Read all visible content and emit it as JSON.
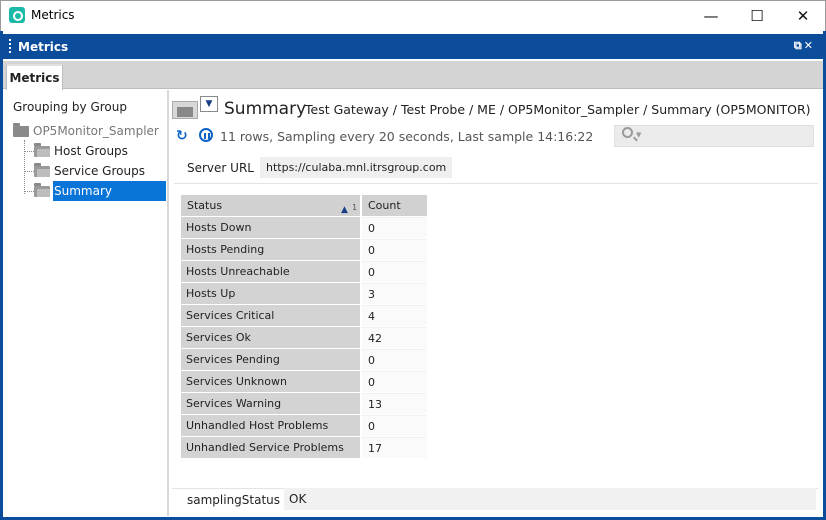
{
  "window": {
    "title": "Metrics",
    "minimize": "—",
    "maximize": "☐",
    "close": "✕"
  },
  "panel": {
    "header_title": "Metrics",
    "header_controls": "⧉✕",
    "tab_label": "Metrics"
  },
  "tree": {
    "grouping_label": "Grouping by Group",
    "root_label": "OP5Monitor_Sampler",
    "items": [
      {
        "label": "Host Groups"
      },
      {
        "label": "Service Groups"
      },
      {
        "label": "Summary"
      }
    ],
    "selected": "Summary"
  },
  "view": {
    "title": "Summary",
    "path": "Test Gateway / Test Probe / ME / OP5Monitor_Sampler / Summary (OP5MONITOR)",
    "status": "11 rows, Sampling every 20 seconds, Last sample 14:16:22",
    "filter_icon_glyph": "▼",
    "refresh_glyph": "↻",
    "search_caret": "▼",
    "accent_color": "#0b4d9b",
    "selection_color": "#0874d8"
  },
  "headline": {
    "server_url_label": "Server URL",
    "server_url_value": "https://culaba.mnl.itrsgroup.com"
  },
  "table": {
    "columns": [
      "Status",
      "Count"
    ],
    "sort_arrow": "▲",
    "sort_index": "1",
    "rows": [
      {
        "name": "Hosts Down",
        "count": "0"
      },
      {
        "name": "Hosts Pending",
        "count": "0"
      },
      {
        "name": "Hosts Unreachable",
        "count": "0"
      },
      {
        "name": "Hosts Up",
        "count": "3"
      },
      {
        "name": "Services Critical",
        "count": "4"
      },
      {
        "name": "Services Ok",
        "count": "42"
      },
      {
        "name": "Services Pending",
        "count": "0"
      },
      {
        "name": "Services Unknown",
        "count": "0"
      },
      {
        "name": "Services Warning",
        "count": "13"
      },
      {
        "name": "Unhandled Host Problems",
        "count": "0"
      },
      {
        "name": "Unhandled Service Problems",
        "count": "17"
      }
    ]
  },
  "footer": {
    "label": "samplingStatus",
    "value": "OK"
  }
}
